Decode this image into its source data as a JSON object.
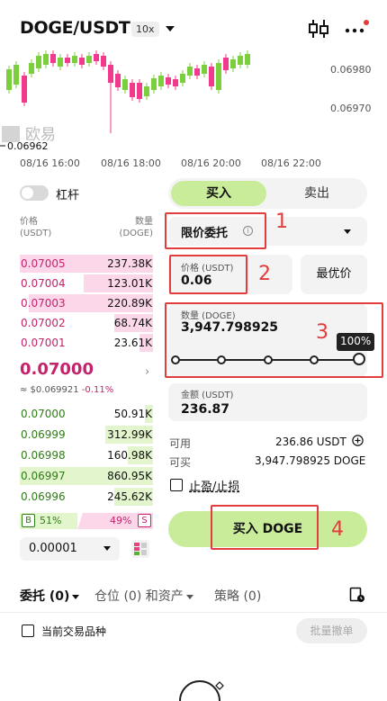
{
  "header": {
    "pair": "DOGE/USDT",
    "leverage": "10x",
    "icons": [
      "candle-settings-icon",
      "more-icon"
    ]
  },
  "chart": {
    "price_labels": [
      "0.06980",
      "0.06970"
    ],
    "low_marker": "0.06962",
    "watermark": "欧易",
    "time_labels": [
      "08/16 16:00",
      "08/16 18:00",
      "08/16 20:00",
      "08/16 22:00"
    ]
  },
  "margin": {
    "label": "杠杆",
    "enabled": false
  },
  "tabs": {
    "buy": "买入",
    "sell": "卖出"
  },
  "orderbook": {
    "price_header": "价格",
    "price_unit": "(USDT)",
    "qty_header": "数量",
    "qty_unit": "(DOGE)",
    "asks": [
      {
        "price": "0.07005",
        "qty": "237.38K",
        "depth": 1.0
      },
      {
        "price": "0.07004",
        "qty": "123.01K",
        "depth": 0.52
      },
      {
        "price": "0.07003",
        "qty": "220.89K",
        "depth": 0.93
      },
      {
        "price": "0.07002",
        "qty": "68.74K",
        "depth": 0.29
      },
      {
        "price": "0.07001",
        "qty": "23.61K",
        "depth": 0.1
      }
    ],
    "last_price": "0.07000",
    "fiat_approx": "≈ $0.069921",
    "change_pct": "-0.11%",
    "bids": [
      {
        "price": "0.07000",
        "qty": "50.91K",
        "depth": 0.06
      },
      {
        "price": "0.06999",
        "qty": "312.99K",
        "depth": 0.36
      },
      {
        "price": "0.06998",
        "qty": "160.98K",
        "depth": 0.19
      },
      {
        "price": "0.06997",
        "qty": "860.95K",
        "depth": 1.0
      },
      {
        "price": "0.06996",
        "qty": "245.62K",
        "depth": 0.29
      }
    ],
    "buy_badge": "B",
    "buy_ratio": "51%",
    "sell_ratio": "49%",
    "sell_badge": "S",
    "precision": "0.00001"
  },
  "form": {
    "order_type": "限价委托",
    "price_label": "价格 (USDT)",
    "price_value": "0.06",
    "best_price": "最优价",
    "qty_label": "数量 (DOGE)",
    "qty_value": "3,947.798925",
    "slider_pct": "100%",
    "amount_label": "金额 (USDT)",
    "amount_value": "236.87",
    "available_label": "可用",
    "available_value": "236.86 USDT",
    "can_buy_label": "可买",
    "can_buy_value": "3,947.798925 DOGE",
    "tpsl_label": "止盈/止损",
    "submit": "买入 DOGE"
  },
  "annotations": [
    "1",
    "2",
    "3",
    "4"
  ],
  "bottom": {
    "tab_orders": "委托 (0)",
    "tab_positions": "仓位 (0) 和资产",
    "tab_strategy": "策略 (0)",
    "current_pair": "当前交易品种",
    "batch_cancel": "批量撤单"
  },
  "colors": {
    "buy": "#c9ec9a",
    "ask_text": "#c4226b",
    "bid_text": "#2f7d16",
    "annotation": "#e33c3c"
  }
}
